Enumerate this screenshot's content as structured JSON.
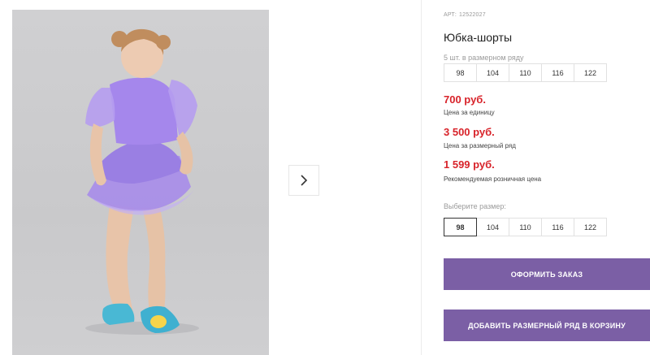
{
  "product": {
    "art_label": "АРТ:",
    "art_number": "12522027",
    "title": "Юбка-шорты",
    "pack_label": "5 шт. в размерном ряду",
    "pack_sizes": [
      "98",
      "104",
      "110",
      "116",
      "122"
    ],
    "prices": {
      "unit_price": "700 руб.",
      "unit_note": "Цена за единицу",
      "pack_price": "3 500 руб.",
      "pack_note": "Цена за размерный ряд",
      "retail_price": "1 599 руб.",
      "retail_note": "Рекомендуемая розничная цена"
    },
    "choose_label": "Выберите размер:",
    "sizes": [
      "98",
      "104",
      "110",
      "116",
      "122"
    ],
    "selected_size": "98"
  },
  "buttons": {
    "order": "ОФОРМИТЬ ЗАКАЗ",
    "add_pack": "ДОБАВИТЬ РАЗМЕРНЫЙ РЯД В КОРЗИНУ"
  },
  "colors": {
    "accent": "#7b5fa5",
    "price": "#d8232a"
  },
  "icons": {
    "next": "chevron-right-icon"
  }
}
